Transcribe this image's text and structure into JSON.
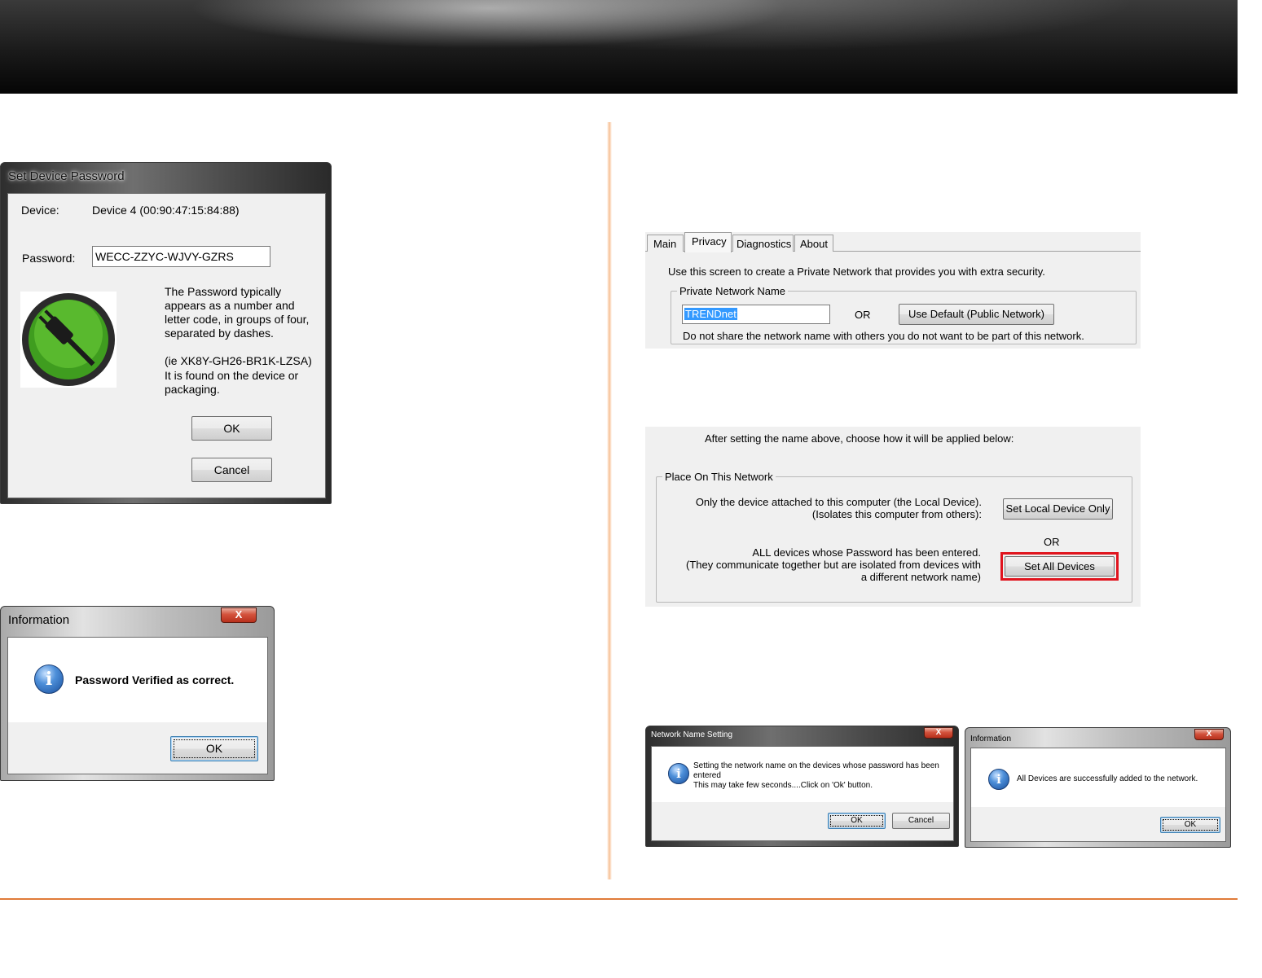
{
  "set_password_dialog": {
    "title": "Set Device Password",
    "device_label": "Device:",
    "device_value": "Device 4  (00:90:47:15:84:88)",
    "password_label": "Password:",
    "password_value": "WECC-ZZYC-WJVY-GZRS",
    "help_line1": "The Password typically",
    "help_line2": "appears as a number and",
    "help_line3": "letter code, in groups of four,",
    "help_line4": "separated by dashes.",
    "help_line5": "(ie XK8Y-GH26-BR1K-LZSA)",
    "help_line6": "It is found on the device or",
    "help_line7": "packaging.",
    "ok_label": "OK",
    "cancel_label": "Cancel",
    "icon": "power-plug-icon",
    "icon_color": "#3f9d1f"
  },
  "info_dialog_1": {
    "title": "Information",
    "close_glyph": "X",
    "message": "Password Verified as correct.",
    "ok_label": "OK",
    "icon": "info-icon"
  },
  "privacy_panel": {
    "tabs": [
      "Main",
      "Privacy",
      "Diagnostics",
      "About"
    ],
    "active_tab": "Privacy",
    "intro": "Use this screen to create a Private Network that provides you with extra security.",
    "group_label": "Private Network Name",
    "network_name": "TRENDnet",
    "or_label": "OR",
    "default_button": "Use Default (Public Network)",
    "note": "Do not share the network name with others you do not want to be part of this network."
  },
  "apply_panel": {
    "intro": "After setting the name above, choose how it will be applied below:",
    "group_label": "Place On This Network",
    "local_line1": "Only the device attached to this computer (the Local Device).",
    "local_line2": "(Isolates this computer from others):",
    "local_button": "Set Local Device Only",
    "or_label": "OR",
    "all_line1": "ALL devices whose Password has been entered.",
    "all_line2": "(They communicate together but are isolated from devices with",
    "all_line3": "a different network name)",
    "all_button": "Set All Devices",
    "highlight_color": "#e0141e"
  },
  "network_name_dialog": {
    "title": "Network Name Setting",
    "close_glyph": "X",
    "line1": "Setting the network name on the devices whose password has been",
    "line2": "entered",
    "line3": "This may take few seconds....Click on 'Ok' button.",
    "ok_label": "OK",
    "cancel_label": "Cancel"
  },
  "info_dialog_2": {
    "title": "Information",
    "close_glyph": "X",
    "message": "All Devices are successfully added to the network.",
    "ok_label": "OK"
  },
  "colors": {
    "accent_orange": "#e07b39",
    "selection_blue": "#3399ff"
  }
}
